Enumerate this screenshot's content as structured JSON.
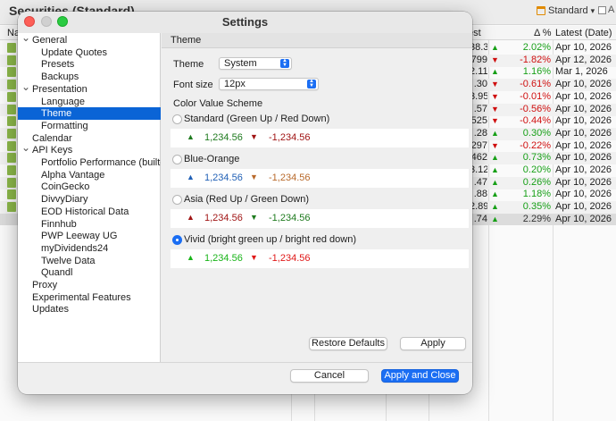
{
  "background_app": {
    "title": "Securities (Standard)",
    "view_name": "Standard",
    "view_menu_glyph": "▾",
    "second_view": "A",
    "columns": {
      "name": "Na",
      "latest_quote": "est",
      "delta_pct": "Δ %",
      "latest_date": "Latest (Date)"
    },
    "rows": [
      {
        "num": "38.3",
        "dir": "up",
        "pct": "2.02%",
        "date": "Apr 10, 2026"
      },
      {
        "num": "799",
        "dir": "down",
        "pct": "-1.82%",
        "date": "Apr 12, 2026"
      },
      {
        "num": "2.11",
        "dir": "up",
        "pct": "1.16%",
        "date": "Mar 1, 2026"
      },
      {
        "num": ".30",
        "dir": "down",
        "pct": "-0.61%",
        "date": "Apr 10, 2026"
      },
      {
        "num": "3.95",
        "dir": "down",
        "pct": "-0.01%",
        "date": "Apr 10, 2026"
      },
      {
        "num": ".57",
        "dir": "down",
        "pct": "-0.56%",
        "date": "Apr 10, 2026"
      },
      {
        "num": "525",
        "dir": "down",
        "pct": "-0.44%",
        "date": "Apr 10, 2026"
      },
      {
        "num": ".28",
        "dir": "up",
        "pct": "0.30%",
        "date": "Apr 10, 2026"
      },
      {
        "num": "297",
        "dir": "down",
        "pct": "-0.22%",
        "date": "Apr 10, 2026"
      },
      {
        "num": "462",
        "dir": "up",
        "pct": "0.73%",
        "date": "Apr 10, 2026"
      },
      {
        "num": "3.12",
        "dir": "up",
        "pct": "0.20%",
        "date": "Apr 10, 2026"
      },
      {
        "num": ".47",
        "dir": "up",
        "pct": "0.26%",
        "date": "Apr 10, 2026"
      },
      {
        "num": ".88",
        "dir": "up",
        "pct": "1.18%",
        "date": "Apr 10, 2026"
      },
      {
        "num": "2.89",
        "dir": "up",
        "pct": "0.35%",
        "date": "Apr 10, 2026"
      },
      {
        "num": ".74",
        "dir": "up",
        "pct": "2.29%",
        "date": "Apr 10, 2026"
      }
    ]
  },
  "dialog": {
    "title": "Settings",
    "tree": [
      {
        "label": "General",
        "level": 0,
        "expanded": true
      },
      {
        "label": "Update Quotes",
        "level": 1
      },
      {
        "label": "Presets",
        "level": 1
      },
      {
        "label": "Backups",
        "level": 1
      },
      {
        "label": "Presentation",
        "level": 0,
        "expanded": true
      },
      {
        "label": "Language",
        "level": 1
      },
      {
        "label": "Theme",
        "level": 1,
        "selected": true
      },
      {
        "label": "Formatting",
        "level": 1
      },
      {
        "label": "Calendar",
        "level": 0
      },
      {
        "label": "API Keys",
        "level": 0,
        "expanded": true
      },
      {
        "label": "Portfolio Performance (built-",
        "level": 1
      },
      {
        "label": "Alpha Vantage",
        "level": 1
      },
      {
        "label": "CoinGecko",
        "level": 1
      },
      {
        "label": "DivvyDiary",
        "level": 1
      },
      {
        "label": "EOD Historical Data",
        "level": 1
      },
      {
        "label": "Finnhub",
        "level": 1
      },
      {
        "label": "PWP Leeway UG",
        "level": 1
      },
      {
        "label": "myDividends24",
        "level": 1
      },
      {
        "label": "Twelve Data",
        "level": 1
      },
      {
        "label": "Quandl",
        "level": 1
      },
      {
        "label": "Proxy",
        "level": 0
      },
      {
        "label": "Experimental Features",
        "level": 0
      },
      {
        "label": "Updates",
        "level": 0
      }
    ],
    "panel": {
      "header": "Theme",
      "theme_label": "Theme",
      "theme_value": "System",
      "font_size_label": "Font size",
      "font_size_value": "12px",
      "scheme_label": "Color Value Scheme",
      "schemes": [
        {
          "label": "Standard (Green Up / Red Down)",
          "selected": false,
          "up_value": "1,234.56",
          "down_value": "-1,234.56",
          "up_color": "#1e7a1e",
          "down_color": "#a01414"
        },
        {
          "label": "Blue-Orange",
          "selected": false,
          "up_value": "1,234.56",
          "down_value": "-1,234.56",
          "up_color": "#1f5fb5",
          "down_color": "#b8692a"
        },
        {
          "label": "Asia (Red Up / Green Down)",
          "selected": false,
          "up_value": "1,234.56",
          "down_value": "-1,234.56",
          "up_color": "#a01414",
          "down_color": "#1e7a1e"
        },
        {
          "label": "Vivid (bright green up / bright red down)",
          "selected": true,
          "up_value": "1,234.56",
          "down_value": "-1,234.56",
          "up_color": "#18b418",
          "down_color": "#e01818"
        }
      ],
      "restore_defaults": "Restore Defaults",
      "apply": "Apply"
    },
    "footer": {
      "cancel": "Cancel",
      "apply_and_close": "Apply and Close"
    }
  }
}
